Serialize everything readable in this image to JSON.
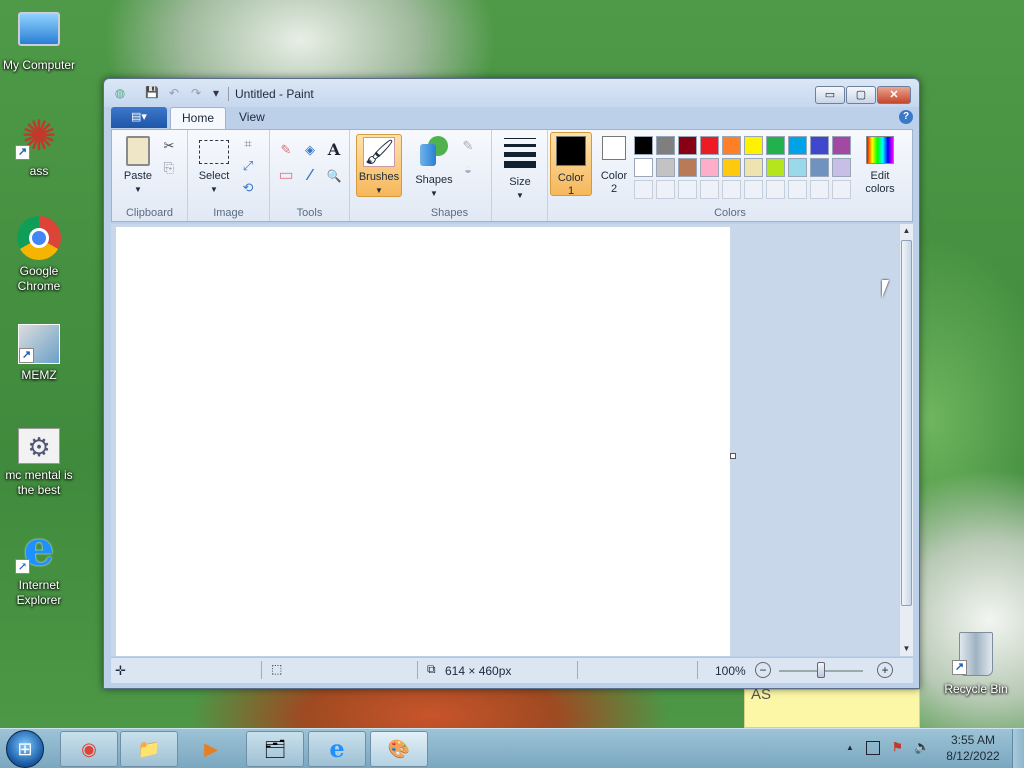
{
  "desktop": {
    "icons": [
      {
        "label": "My Computer",
        "glyph": "🖥"
      },
      {
        "label": "ass",
        "glyph": "✺"
      },
      {
        "label": "Google Chrome",
        "glyph": "◉"
      },
      {
        "label": "MEMZ",
        "glyph": "▤"
      },
      {
        "label": "mc mental is the best",
        "glyph": "⚙"
      },
      {
        "label": "Internet Explorer",
        "glyph": "e"
      },
      {
        "label": "Recycle Bin",
        "glyph": "🗑"
      }
    ]
  },
  "window": {
    "title": "Untitled - Paint",
    "min": "▭",
    "max": "▢",
    "close": "✕"
  },
  "quick_access": {
    "save": "💾",
    "undo": "↶",
    "redo": "↷",
    "customize": "▾"
  },
  "tabs": {
    "file_glyph": "▤▾",
    "home": "Home",
    "view": "View",
    "help": "?"
  },
  "ribbon": {
    "clipboard": {
      "label": "Clipboard",
      "paste": "Paste",
      "paste_glyph": "📋",
      "cut": "✂",
      "copy": "⎘"
    },
    "image": {
      "label": "Image",
      "select": "Select",
      "crop": "⌗",
      "resize": "⤢",
      "rotate": "⟲"
    },
    "tools": {
      "label": "Tools",
      "pencil": "✎",
      "fill": "◈",
      "text": "A",
      "eraser": "▭",
      "picker": "⁄",
      "magnifier": "🔍"
    },
    "brushes": {
      "label": "Brushes",
      "glyph": "🖌"
    },
    "shapes": {
      "label": "Shapes",
      "btn": "Shapes",
      "outline": "✎",
      "fill": "◒"
    },
    "size": {
      "label": "Size"
    },
    "colors": {
      "label": "Colors",
      "color1": "Color 1",
      "color1_value": "#000000",
      "color2": "Color 2",
      "color2_value": "#ffffff",
      "edit": "Edit colors",
      "palette_row1": [
        "#000000",
        "#7f7f7f",
        "#880015",
        "#ed1c24",
        "#ff7f27",
        "#fff200",
        "#22b14c",
        "#00a2e8",
        "#3f48cc",
        "#a349a4"
      ],
      "palette_row2": [
        "#ffffff",
        "#c3c3c3",
        "#b97a57",
        "#ffaec9",
        "#ffc90e",
        "#efe4b0",
        "#b5e61d",
        "#99d9ea",
        "#7092be",
        "#c8bfe7"
      ]
    }
  },
  "status": {
    "canvas_size": "614 × 460px",
    "zoom": "100%",
    "zoom_out": "−",
    "zoom_in": "+"
  },
  "sticky_note": {
    "text": "AS"
  },
  "taskbar": {
    "start": "⊞",
    "apps": [
      "◉",
      "📁",
      "▶",
      "🗂",
      "e",
      "🎨"
    ],
    "time": "3:55 AM",
    "date": "8/12/2022",
    "tray_up": "▲",
    "speaker": "🔈"
  }
}
